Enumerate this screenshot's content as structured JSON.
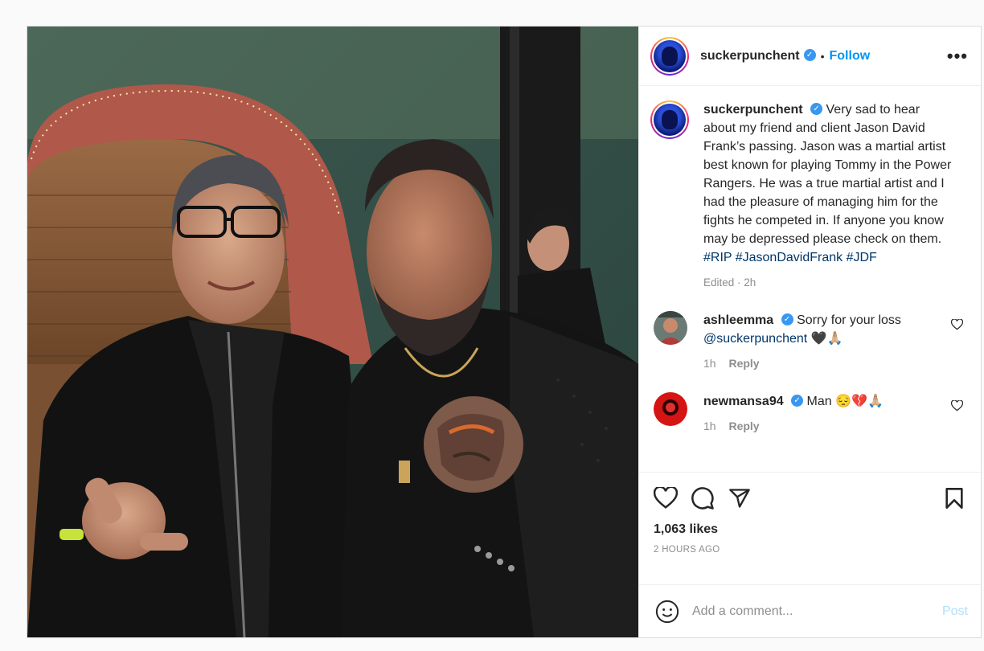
{
  "post": {
    "username": "suckerpunchent",
    "follow_label": "Follow",
    "separator": "•",
    "more_label": "•••",
    "caption": {
      "username": "suckerpunchent",
      "text": "Very sad to hear about my friend and client Jason David Frank’s passing. Jason was a martial artist best known for playing Tommy in the Power Rangers. He was a true martial artist and I had the pleasure of managing him for the fights he competed in. If anyone you know may be depressed please check on them.",
      "tags": [
        "#RIP",
        "#JasonDavidFrank",
        "#JDF"
      ],
      "meta": "Edited · 2h"
    },
    "comments": [
      {
        "username": "ashleemma",
        "text": "Sorry for your loss",
        "mention": "@suckerpunchent",
        "emoji": "🖤🙏🏼",
        "time": "1h",
        "reply_label": "Reply"
      },
      {
        "username": "newmansa94",
        "text": "Man",
        "emoji": "😔💔🙏🏼",
        "time": "1h",
        "reply_label": "Reply"
      }
    ],
    "likes": "1,063 likes",
    "timestamp": "2 HOURS AGO",
    "add_comment_placeholder": "Add a comment...",
    "post_label": "Post"
  },
  "icons": {
    "like": "heart-icon",
    "comment": "comment-icon",
    "share": "share-icon",
    "save": "bookmark-icon",
    "emoji": "emoji-icon",
    "verified": "verified-badge-icon"
  },
  "colors": {
    "link_blue": "#0095f6",
    "verified_blue": "#3897f0",
    "hashtag": "#00376b",
    "muted": "#8e8e8e",
    "post_disabled": "#b2dffc"
  }
}
